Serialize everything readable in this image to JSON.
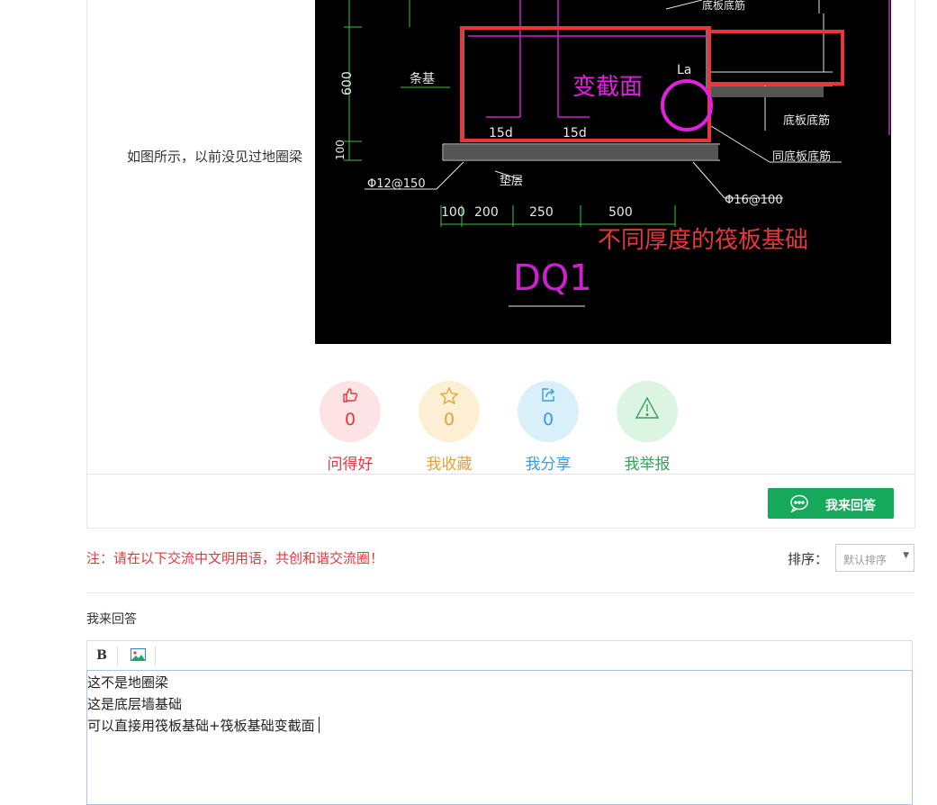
{
  "post": {
    "caption": "如图所示，以前没见过地圈梁",
    "figure": {
      "dim_600": "600",
      "dim_100": "100",
      "label_tiaoji": "条基",
      "label_dibanjian": "底板底筋",
      "label_dibandijin": "底板底筋",
      "label_tongdiban": "同底板底筋",
      "label_dianceng": "垫层",
      "rebar_left": "Φ12@150",
      "rebar_right": "Φ16@100",
      "dims_bottom": [
        "100",
        "200",
        "250",
        "500"
      ],
      "label_15d_a": "15d",
      "label_15d_b": "15d",
      "label_La": "La",
      "label_section_change": "变截面",
      "label_raft": "不同厚度的筏板基础",
      "label_dq1": "DQ1"
    }
  },
  "actions": [
    {
      "label": "问得好",
      "count": "0",
      "icon": "thumbs-up-icon",
      "color": "#e0393e",
      "bg": "#fde3e6"
    },
    {
      "label": "我收藏",
      "count": "0",
      "icon": "star-icon",
      "color": "#e0a23c",
      "bg": "#fdefd3"
    },
    {
      "label": "我分享",
      "count": "0",
      "icon": "share-icon",
      "color": "#3b9cd9",
      "bg": "#d9f0fb"
    },
    {
      "label": "我举报",
      "count": "",
      "icon": "warning-icon",
      "color": "#3aa05a",
      "bg": "#dcf5e3"
    }
  ],
  "answer_button": {
    "label": "我来回答",
    "icon": "chat-bubble-icon",
    "color": "#17a95b"
  },
  "notice": "注：请在以下交流中文明用语，共创和谐交流圈！",
  "sort": {
    "label": "排序：",
    "selected": "默认排序"
  },
  "reply": {
    "title": "我来回答",
    "toolbar": {
      "bold": "B",
      "image_icon": "image-icon"
    },
    "lines": [
      "这不是地圈梁",
      "这是底层墙基础",
      "可以直接用筏板基础+筏板基础变截面"
    ]
  }
}
